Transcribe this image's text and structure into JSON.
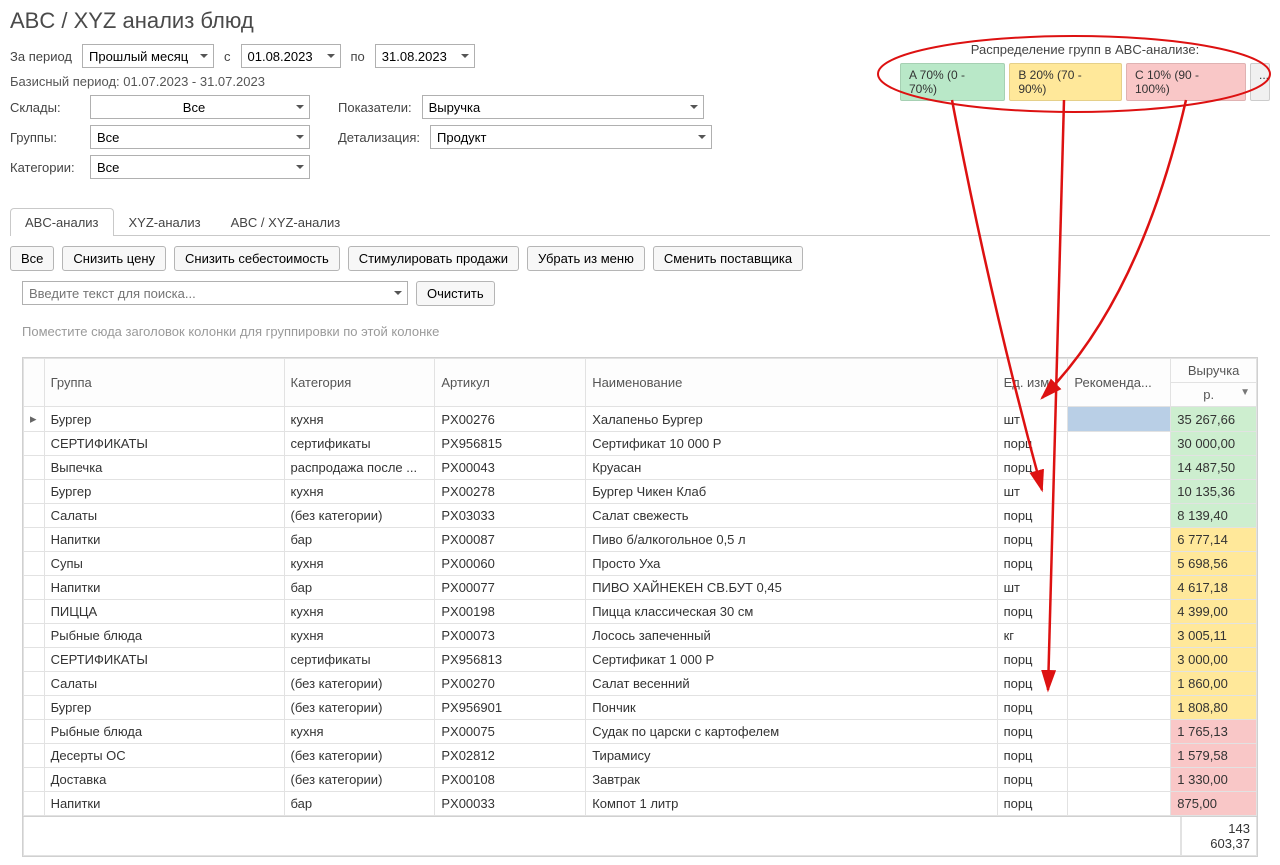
{
  "title": "ABC / XYZ анализ блюд",
  "filters": {
    "period_label": "За период",
    "period_value": "Прошлый месяц",
    "from_label": "с",
    "from_value": "01.08.2023",
    "to_label": "по",
    "to_value": "31.08.2023",
    "base_period": "Базисный период: 01.07.2023 - 31.07.2023",
    "stores_label": "Склады:",
    "stores_value": "Все",
    "indicators_label": "Показатели:",
    "indicators_value": "Выручка",
    "groups_label": "Группы:",
    "groups_value": "Все",
    "detail_label": "Детализация:",
    "detail_value": "Продукт",
    "categories_label": "Категории:",
    "categories_value": "Все"
  },
  "abc_legend": {
    "label": "Распределение групп в ABC-анализе:",
    "a": "A 70% (0 - 70%)",
    "b": "B 20% (70 - 90%)",
    "c": "C 10% (90 - 100%)",
    "more": "..."
  },
  "tabs": [
    {
      "label": "ABC-анализ",
      "active": true
    },
    {
      "label": "XYZ-анализ",
      "active": false
    },
    {
      "label": "ABC / XYZ-анализ",
      "active": false
    }
  ],
  "action_buttons": [
    "Все",
    "Снизить цену",
    "Снизить себестоимость",
    "Стимулировать продажи",
    "Убрать из меню",
    "Сменить поставщика"
  ],
  "search": {
    "placeholder": "Введите текст для поиска...",
    "clear": "Очистить"
  },
  "group_hint": "Поместите сюда заголовок колонки для группировки по этой колонке",
  "columns": {
    "superhead": "Выручка",
    "group": "Группа",
    "category": "Категория",
    "article": "Артикул",
    "name": "Наименование",
    "unit": "Ед. изм.",
    "reco": "Рекоменда...",
    "rev": "р."
  },
  "rows": [
    {
      "group": "Бургер",
      "category": "кухня",
      "article": "PX00276",
      "name": "Халапеньо Бургер",
      "unit": "шт",
      "reco_sel": true,
      "rev": "35 267,66",
      "cls": "A"
    },
    {
      "group": "СЕРТИФИКАТЫ",
      "category": "сертификаты",
      "article": "PX956815",
      "name": "Сертификат 10 000 Р",
      "unit": "порц",
      "rev": "30 000,00",
      "cls": "A"
    },
    {
      "group": "Выпечка",
      "category": "распродажа после ...",
      "article": "PX00043",
      "name": "Круасан",
      "unit": "порц",
      "rev": "14 487,50",
      "cls": "A"
    },
    {
      "group": "Бургер",
      "category": "кухня",
      "article": "PX00278",
      "name": "Бургер Чикен Клаб",
      "unit": "шт",
      "rev": "10 135,36",
      "cls": "A"
    },
    {
      "group": "Салаты",
      "category": "(без категории)",
      "article": "PX03033",
      "name": "Салат свежесть",
      "unit": "порц",
      "rev": "8 139,40",
      "cls": "A"
    },
    {
      "group": "Напитки",
      "category": "бар",
      "article": "PX00087",
      "name": "Пиво б/алкогольное 0,5 л",
      "unit": "порц",
      "rev": "6 777,14",
      "cls": "B"
    },
    {
      "group": "Супы",
      "category": "кухня",
      "article": "PX00060",
      "name": "Просто Уха",
      "unit": "порц",
      "rev": "5 698,56",
      "cls": "B"
    },
    {
      "group": "Напитки",
      "category": "бар",
      "article": "PX00077",
      "name": "ПИВО ХАЙНЕКЕН СВ.БУТ 0,45",
      "unit": "шт",
      "rev": "4 617,18",
      "cls": "B"
    },
    {
      "group": "ПИЦЦА",
      "category": "кухня",
      "article": "PX00198",
      "name": "Пицца классическая 30 см",
      "unit": "порц",
      "rev": "4 399,00",
      "cls": "B"
    },
    {
      "group": "Рыбные блюда",
      "category": "кухня",
      "article": "PX00073",
      "name": "Лосось запеченный",
      "unit": "кг",
      "rev": "3 005,11",
      "cls": "B"
    },
    {
      "group": "СЕРТИФИКАТЫ",
      "category": "сертификаты",
      "article": "PX956813",
      "name": "Сертификат 1 000 Р",
      "unit": "порц",
      "rev": "3 000,00",
      "cls": "B"
    },
    {
      "group": "Салаты",
      "category": "(без категории)",
      "article": "PX00270",
      "name": "Салат весенний",
      "unit": "порц",
      "rev": "1 860,00",
      "cls": "B"
    },
    {
      "group": "Бургер",
      "category": "(без категории)",
      "article": "PX956901",
      "name": "Пончик",
      "unit": "порц",
      "rev": "1 808,80",
      "cls": "B"
    },
    {
      "group": "Рыбные блюда",
      "category": "кухня",
      "article": "PX00075",
      "name": "Судак по царски с картофелем",
      "unit": "порц",
      "rev": "1 765,13",
      "cls": "C"
    },
    {
      "group": "Десерты ОС",
      "category": "(без категории)",
      "article": "PX02812",
      "name": "Тирамису",
      "unit": "порц",
      "rev": "1 579,58",
      "cls": "C"
    },
    {
      "group": "Доставка",
      "category": "(без категории)",
      "article": "PX00108",
      "name": "Завтрак",
      "unit": "порц",
      "rev": "1 330,00",
      "cls": "C"
    },
    {
      "group": "Напитки",
      "category": "бар",
      "article": "PX00033",
      "name": "Компот 1 литр",
      "unit": "порц",
      "rev": "875,00",
      "cls": "C"
    }
  ],
  "total": "143 603,37"
}
